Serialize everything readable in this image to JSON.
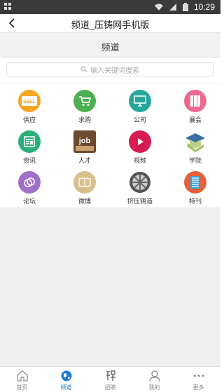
{
  "statusbar": {
    "time": "10:29"
  },
  "titlebar": {
    "title": "频道_压铸网手机版"
  },
  "header": {
    "title": "频道"
  },
  "search": {
    "placeholder": "输入关键词搜索"
  },
  "grid": [
    {
      "label": "供应",
      "icon": "sell-icon",
      "color": "#f5a623"
    },
    {
      "label": "求购",
      "icon": "cart-icon",
      "color": "#4caf50"
    },
    {
      "label": "公司",
      "icon": "monitor-icon",
      "color": "#26a69a"
    },
    {
      "label": "展会",
      "icon": "exhibit-icon",
      "color": "#ec6a8e"
    },
    {
      "label": "资讯",
      "icon": "news-icon",
      "color": "#29b07a"
    },
    {
      "label": "人才",
      "icon": "job-icon",
      "color": "#7a5a3a"
    },
    {
      "label": "视频",
      "icon": "play-icon",
      "color": "#d81b50"
    },
    {
      "label": "学院",
      "icon": "academy-icon",
      "color": "#5aa0d8"
    },
    {
      "label": "论坛",
      "icon": "forum-icon",
      "color": "#a070c8"
    },
    {
      "label": "微博",
      "icon": "book-icon",
      "color": "#d8c08a"
    },
    {
      "label": "挤压铸造",
      "icon": "wheel-icon",
      "color": "#555555"
    },
    {
      "label": "特刊",
      "icon": "magazine-icon",
      "color": "#e8603a"
    }
  ],
  "tabs": [
    {
      "label": "首页",
      "icon": "home-icon",
      "active": false
    },
    {
      "label": "频道",
      "icon": "globe-icon",
      "active": true
    },
    {
      "label": "招聘",
      "icon": "recruit-icon",
      "active": false
    },
    {
      "label": "我的",
      "icon": "user-icon",
      "active": false
    },
    {
      "label": "更多",
      "icon": "more-icon",
      "active": false
    }
  ],
  "colors": {
    "accent": "#1a7fd4",
    "statusbar": "#3a3a3a"
  }
}
